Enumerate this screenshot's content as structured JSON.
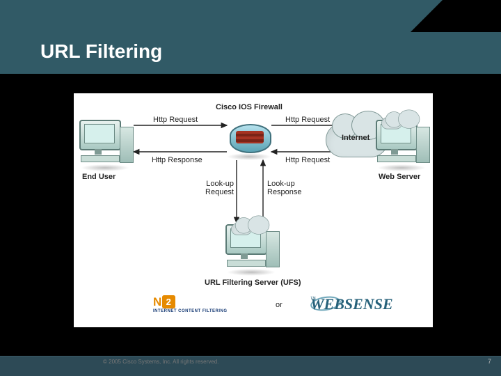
{
  "slide": {
    "title": "URL Filtering",
    "copyright": "© 2005 Cisco Systems, Inc. All rights reserved.",
    "page_number": "7"
  },
  "diagram": {
    "nodes": {
      "firewall": "Cisco IOS Firewall",
      "end_user": "End User",
      "internet": "Internet",
      "web_server": "Web Server",
      "ufs": "URL Filtering Server (UFS)"
    },
    "flows": {
      "http_request_1": "Http Request",
      "http_request_2": "Http Request",
      "http_request_3": "Http Request",
      "http_response": "Http Response",
      "lookup_request": "Look-up\nRequest",
      "lookup_response": "Look-up\nResponse"
    },
    "vendors": {
      "n2h2_name": "N2H2",
      "n2h2_tagline": "INTERNET CONTENT FILTERING",
      "or": "or",
      "websense_name": "WEBSENSE",
      "websense_tm": "™"
    }
  }
}
